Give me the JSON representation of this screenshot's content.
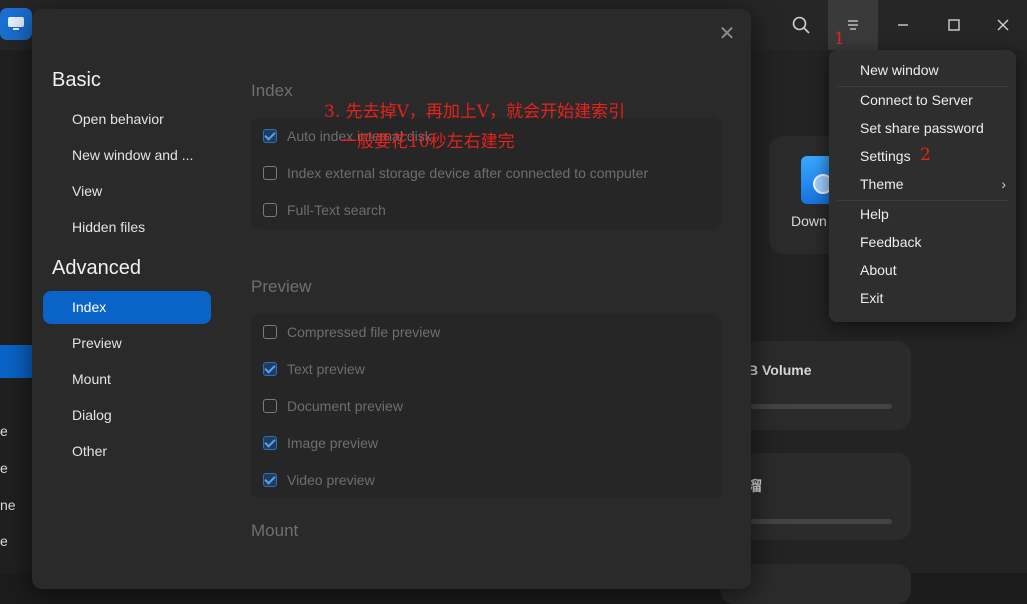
{
  "background": {
    "card_download_label": "Down",
    "card_volume_label": "B Volume",
    "card_second_label": "溜",
    "left_fragments": [
      "e",
      "e",
      "ne",
      "e"
    ]
  },
  "dialog": {
    "nav": {
      "basic_title": "Basic",
      "basic_items": [
        "Open behavior",
        "New window and ...",
        "View",
        "Hidden files"
      ],
      "advanced_title": "Advanced",
      "advanced_items": [
        "Index",
        "Preview",
        "Mount",
        "Dialog",
        "Other"
      ]
    },
    "sections": {
      "index": {
        "title": "Index",
        "options": [
          {
            "label": "Auto index internal disk",
            "checked": true
          },
          {
            "label": "Index external storage device after connected to computer",
            "checked": false
          },
          {
            "label": "Full-Text search",
            "checked": false
          }
        ]
      },
      "preview": {
        "title": "Preview",
        "options": [
          {
            "label": "Compressed file preview",
            "checked": false
          },
          {
            "label": "Text preview",
            "checked": true
          },
          {
            "label": "Document preview",
            "checked": false
          },
          {
            "label": "Image preview",
            "checked": true
          },
          {
            "label": "Video preview",
            "checked": true
          }
        ]
      },
      "mount": {
        "title": "Mount"
      }
    }
  },
  "menu": {
    "items": {
      "new_window": "New window",
      "connect_server": "Connect to Server",
      "share_password": "Set share password",
      "settings": "Settings",
      "theme": "Theme",
      "help": "Help",
      "feedback": "Feedback",
      "about": "About",
      "exit": "Exit"
    }
  },
  "annotations": {
    "step1": "1",
    "step2": "2",
    "step3_line1": "3. 先去掉V，再加上V，就会开始建索引",
    "step3_line2": "一般要花10秒左右建完"
  }
}
